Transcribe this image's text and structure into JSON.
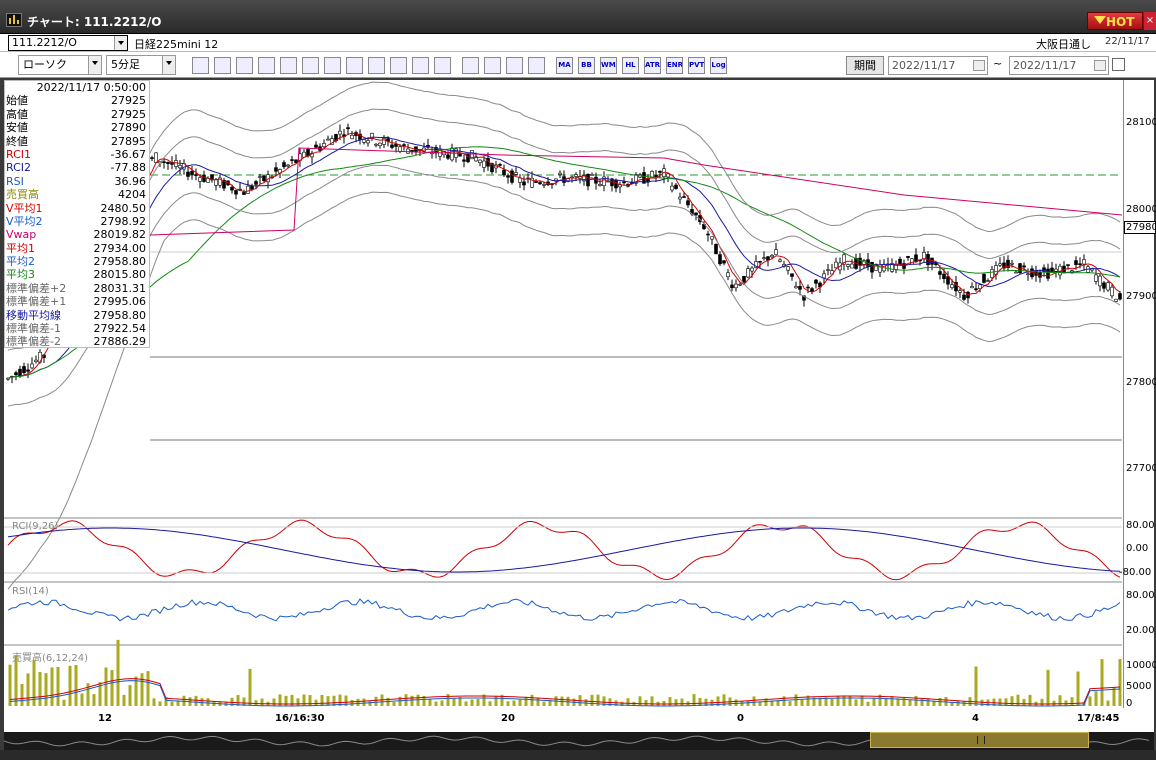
{
  "window": {
    "title": "チャート: 111.2212/O",
    "hot_label": "HOT",
    "close_label": "×"
  },
  "instrument": {
    "code": "111.2212/O",
    "name": "日経225mini 12",
    "market": "大阪日通し",
    "market_date": "22/11/17"
  },
  "controls": {
    "chart_type": "ローソク",
    "interval": "5分足",
    "period_button": "期間",
    "date_from": "2022/11/17",
    "date_to": "2022/11/17",
    "tilde": "~",
    "toolbar_icons": [
      "zoom-icon",
      "crosshair-icon",
      "trend-icon",
      "search-icon",
      "compare-icon",
      "clear-icon",
      "pen-icon",
      "pointer-icon",
      "undo-icon",
      "candle-icon",
      "bar-icon",
      "all-icon",
      "settings-icon",
      "paint-icon",
      "color-icon",
      "grid-icon"
    ],
    "toolbar_text_buttons": [
      "MA",
      "BB",
      "WMA",
      "HL",
      "ATR",
      "ENRA",
      "PVT",
      "Log"
    ]
  },
  "info_panel": {
    "datetime": "2022/11/17  0:50:00",
    "rows": [
      {
        "label": "始値",
        "value": "27925",
        "color": "#000000"
      },
      {
        "label": "高値",
        "value": "27925",
        "color": "#000000"
      },
      {
        "label": "安値",
        "value": "27890",
        "color": "#000000"
      },
      {
        "label": "終値",
        "value": "27895",
        "color": "#000000"
      },
      {
        "label": "RCI1",
        "value": "-36.67",
        "color": "#d00000"
      },
      {
        "label": "RCI2",
        "value": "-77.88",
        "color": "#1a1aa0"
      },
      {
        "label": "RSI",
        "value": "36.96",
        "color": "#1a5acc"
      },
      {
        "label": "売買高",
        "value": "4204",
        "color": "#8a8a00"
      },
      {
        "label": "V平均1",
        "value": "2480.50",
        "color": "#d00000"
      },
      {
        "label": "V平均2",
        "value": "2798.92",
        "color": "#1a5acc"
      },
      {
        "label": "Vwap",
        "value": "28019.82",
        "color": "#cc0066"
      },
      {
        "label": "平均1",
        "value": "27934.00",
        "color": "#d00000"
      },
      {
        "label": "平均2",
        "value": "27958.80",
        "color": "#1a5acc"
      },
      {
        "label": "平均3",
        "value": "28015.80",
        "color": "#138a13"
      },
      {
        "label": "標準偏差+2",
        "value": "28031.31",
        "color": "#666666"
      },
      {
        "label": "標準偏差+1",
        "value": "27995.06",
        "color": "#666666"
      },
      {
        "label": "移動平均線",
        "value": "27958.80",
        "color": "#1a1aa0"
      },
      {
        "label": "標準偏差-1",
        "value": "27922.54",
        "color": "#666666"
      },
      {
        "label": "標準偏差-2",
        "value": "27886.29",
        "color": "#666666"
      }
    ]
  },
  "axes": {
    "price_ticks": [
      "28100",
      "28000",
      "27900",
      "27800",
      "27700"
    ],
    "current_price": "27980",
    "rci_ticks": [
      "80.00",
      "0.00",
      "-80.00"
    ],
    "rsi_ticks": [
      "80.00",
      "20.00"
    ],
    "volume_ticks": [
      "10000",
      "5000",
      "0"
    ],
    "x_labels": [
      "12",
      "16/16:30",
      "20",
      "0",
      "4",
      "17/8:45"
    ]
  },
  "subcharts": {
    "rci_label": "RCI(9,26)",
    "rsi_label": "RSI(14)",
    "volume_label": "売買高(6,12,24)"
  },
  "colors": {
    "candle_up": "#ffffff",
    "candle_down": "#000000",
    "ma1": "#d00000",
    "ma2": "#1a1aa0",
    "ma3": "#138a13",
    "vwap": "#cc0066",
    "bb": "#8a8a8a",
    "volume": "#aaaa22",
    "dashed": "#2a9a2a"
  }
}
